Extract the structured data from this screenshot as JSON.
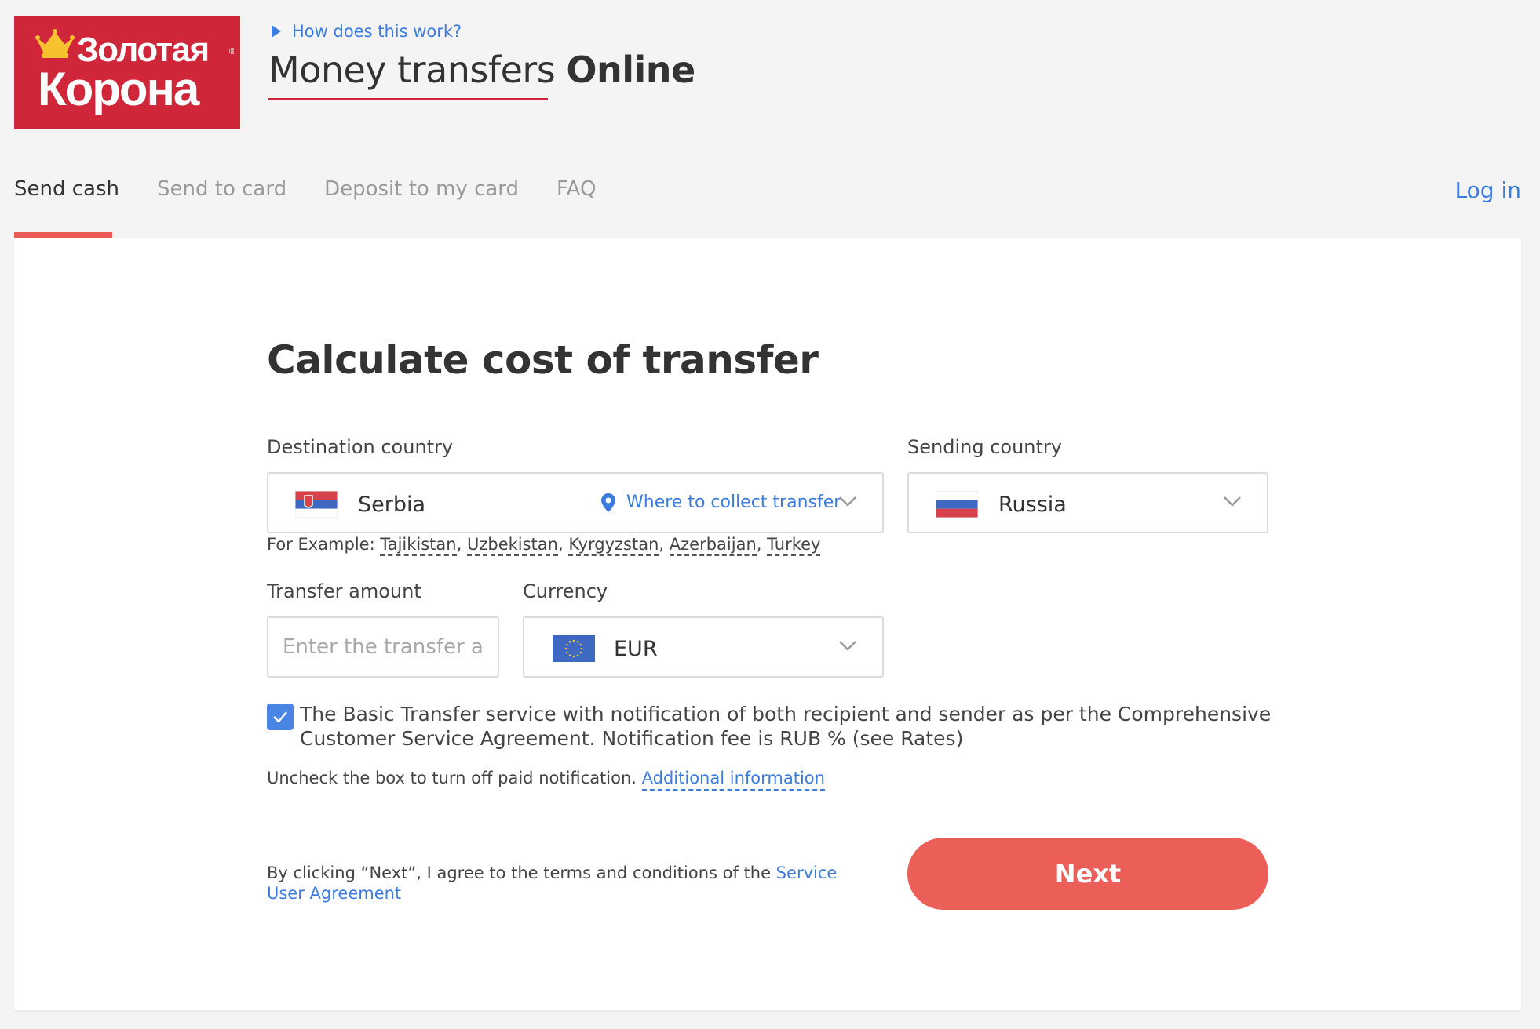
{
  "header": {
    "logo_line1": "Золотая",
    "logo_line2": "Корона",
    "logo_reg": "®",
    "how_link": "How does this work?",
    "title_light": "Money transfers ",
    "title_bold": "Online"
  },
  "tabs": [
    {
      "label": "Send cash",
      "active": true
    },
    {
      "label": "Send to card",
      "active": false
    },
    {
      "label": "Deposit to my card",
      "active": false
    },
    {
      "label": "FAQ",
      "active": false
    }
  ],
  "login_label": "Log in",
  "form": {
    "title": "Calculate cost of transfer",
    "destination_label": "Destination country",
    "destination_value": "Serbia",
    "collect_link": "Where to collect transfer",
    "sending_label": "Sending country",
    "sending_value": "Russia",
    "examples_prefix": "For Example: ",
    "examples": [
      "Tajikistan",
      "Uzbekistan",
      "Kyrgyzstan",
      "Azerbaijan",
      "Turkey"
    ],
    "amount_label": "Transfer amount",
    "amount_placeholder": "Enter the transfer amount",
    "amount_value": "",
    "currency_label": "Currency",
    "currency_value": "EUR",
    "notification_checked": true,
    "notification_text": "The Basic Transfer service with notification of both recipient and sender as per the Comprehensive Customer Service Agreement. Notification fee is RUB % (see Rates)",
    "uncheck_note": "Uncheck the box to turn off paid notification. ",
    "additional_info": "Additional information",
    "agree_text": "By clicking “Next”, I agree to the terms and conditions of the ",
    "agree_link": "Service User Agreement",
    "next_label": "Next"
  },
  "colors": {
    "brand_red": "#d0263a",
    "accent_red": "#ec5f58",
    "link_blue": "#3c7ce0",
    "page_bg": "#f4f4f4"
  },
  "icons": {
    "how_link": "play-triangle-icon",
    "collect": "map-pin-icon",
    "dropdown": "chevron-down-icon",
    "checkbox": "checkmark-icon",
    "logo": "crown-icon"
  }
}
